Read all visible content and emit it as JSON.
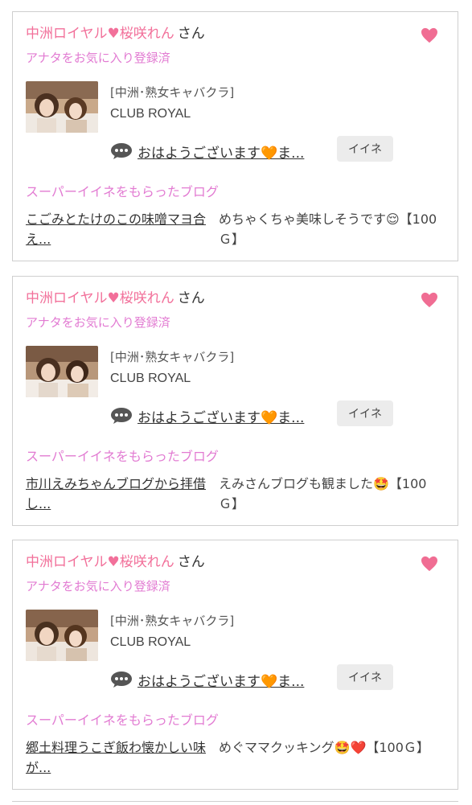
{
  "colors": {
    "name_pink": "#f2709a",
    "label_purple_pink": "#e27bd2",
    "heart_pink": "#f06d93",
    "border_gray": "#cfcfcf",
    "button_gray": "#ececec"
  },
  "icons": {
    "favorite": "heart-icon",
    "message": "chat-bubble-icon"
  },
  "cards": [
    {
      "cast_name": "中洲ロイヤル♥桜咲れん",
      "honorific": "さん",
      "favorite_status": "アナタをお気に入り登録済",
      "shop_category": "[中洲･熟女キャバクラ]",
      "shop_name": "CLUB ROYAL",
      "message": "おはようございます🧡ま...",
      "iine_label": "イイネ",
      "super_like_label": "スーパーイイネをもらったブログ",
      "blog_title": "こごみとたけのこの味噌マヨ合え...",
      "comment": "めちゃくちゃ美味しそうです😌【100Ｇ】"
    },
    {
      "cast_name": "中洲ロイヤル♥桜咲れん",
      "honorific": "さん",
      "favorite_status": "アナタをお気に入り登録済",
      "shop_category": "[中洲･熟女キャバクラ]",
      "shop_name": "CLUB ROYAL",
      "message": "おはようございます🧡ま...",
      "iine_label": "イイネ",
      "super_like_label": "スーパーイイネをもらったブログ",
      "blog_title": "市川えみちゃんブログから拝借し...",
      "comment": "えみさんブログも観ました🤩【100Ｇ】"
    },
    {
      "cast_name": "中洲ロイヤル♥桜咲れん",
      "honorific": "さん",
      "favorite_status": "アナタをお気に入り登録済",
      "shop_category": "[中洲･熟女キャバクラ]",
      "shop_name": "CLUB ROYAL",
      "message": "おはようございます🧡ま...",
      "iine_label": "イイネ",
      "super_like_label": "スーパーイイネをもらったブログ",
      "blog_title": "郷土料理うこぎ飯わ懐かしい味が...",
      "comment": "めぐママクッキング🤩❤️【100Ｇ】"
    }
  ]
}
